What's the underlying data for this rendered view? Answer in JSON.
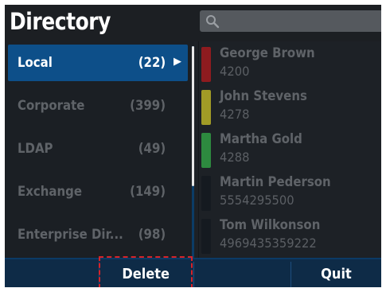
{
  "header": {
    "title": "Directory"
  },
  "search": {
    "placeholder": "",
    "icon": "search-icon"
  },
  "groups": [
    {
      "name": "Local",
      "count": "(22)",
      "selected": true
    },
    {
      "name": "Corporate",
      "count": "(399)"
    },
    {
      "name": "LDAP",
      "count": "(49)"
    },
    {
      "name": "Exchange",
      "count": "(149)"
    },
    {
      "name": "Enterprise Dir...",
      "count": "(98)"
    }
  ],
  "contacts": [
    {
      "name": "George Brown",
      "number": "4200",
      "color": "#8e1b1f"
    },
    {
      "name": "John Stevens",
      "number": "4278",
      "color": "#a19b26"
    },
    {
      "name": "Martha Gold",
      "number": "4288",
      "color": "#2d8a3f"
    },
    {
      "name": "Martin Pederson",
      "number": "5554295500",
      "color": "#151a20"
    },
    {
      "name": "Tom Wilkonson",
      "number": "4969435359222",
      "color": "#151a20"
    }
  ],
  "softkeys": {
    "delete": "Delete",
    "quit": "Quit"
  },
  "colors": {
    "selected": "#0d4f89",
    "softkey_bar": "#0e2b47",
    "highlight": "#d6232a"
  }
}
